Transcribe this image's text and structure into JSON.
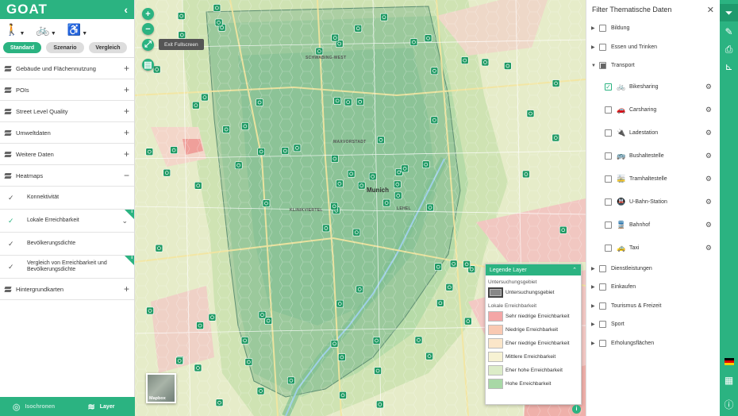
{
  "brand": {
    "logo": "GOAT",
    "collapse_icon": "chevron-left-icon"
  },
  "modes": [
    {
      "name": "walking",
      "icon": "🚶",
      "active": true
    },
    {
      "name": "bicycle",
      "icon": "🚲",
      "active": false
    },
    {
      "name": "wheelchair",
      "icon": "♿",
      "active": false
    }
  ],
  "scenario_tabs": [
    "Standard",
    "Szenario",
    "Vergleich"
  ],
  "sections": [
    "Gebäude und Flächennutzung",
    "POIs",
    "Street Level Quality",
    "Umweltdaten",
    "Weitere Daten",
    "Heatmaps"
  ],
  "heatmaps": [
    "Konnektivität",
    "Lokale Erreichbarkeit",
    "Bevölkerungsdichte",
    "Vergleich von Erreichbarkeit und Bevölkerungsdichte"
  ],
  "background_section": "Hintergrundkarten",
  "bottom_tabs": {
    "isochrones": "Isochronen",
    "layer": "Layer"
  },
  "map": {
    "tooltip": "Exit Fullscreen",
    "city_label": "Munich",
    "minimap_label": "Mapbox",
    "districts": [
      "MAXVORSTADT",
      "LEHEL",
      "KLINIKVIERTEL",
      "SCHWABING-WEST"
    ],
    "colors": {
      "high": "#a6d7a5",
      "med": "#dde8b8",
      "low": "#f4c6c3",
      "area": "#5f9f7a"
    }
  },
  "legend": {
    "title": "Legende Layer",
    "group1": "Untersuchungsgebiet",
    "area_item": "Untersuchungsgebiet",
    "group2": "Lokale Erreichbarkeit",
    "items": [
      {
        "label": "Sehr niedrige Erreichbarkeit",
        "color": "#f4a6a6"
      },
      {
        "label": "Niedrige Erreichbarkeit",
        "color": "#f9c9b2"
      },
      {
        "label": "Eher niedrige Erreichbarkeit",
        "color": "#fbe6c9"
      },
      {
        "label": "Mittlere Erreichbarkeit",
        "color": "#f7f2d3"
      },
      {
        "label": "Eher hohe Erreichbarkeit",
        "color": "#dcecc8"
      },
      {
        "label": "Hohe Erreichbarkeit",
        "color": "#a8d8a6"
      }
    ]
  },
  "filter": {
    "title": "Filter Thematische Daten",
    "top": [
      "Bildung",
      "Essen und Trinken",
      "Transport"
    ],
    "transport": [
      {
        "label": "Bikesharing",
        "icon": "🚲",
        "checked": true
      },
      {
        "label": "Carsharing",
        "icon": "🚗",
        "checked": false
      },
      {
        "label": "Ladestation",
        "icon": "🔌",
        "checked": false
      },
      {
        "label": "Bushaltestelle",
        "icon": "🚌",
        "checked": false
      },
      {
        "label": "Tramhaltestelle",
        "icon": "🚋",
        "checked": false
      },
      {
        "label": "U-Bahn-Station",
        "icon": "🚇",
        "checked": false
      },
      {
        "label": "Bahnhof",
        "icon": "🚆",
        "checked": false
      },
      {
        "label": "Taxi",
        "icon": "🚕",
        "checked": false
      }
    ],
    "rest": [
      "Dienstleistungen",
      "Einkaufen",
      "Tourismus & Freizeit",
      "Sport",
      "Erholungsflächen"
    ]
  },
  "toolbar": [
    "filter-icon",
    "edit-icon",
    "print-icon",
    "measure-icon"
  ]
}
